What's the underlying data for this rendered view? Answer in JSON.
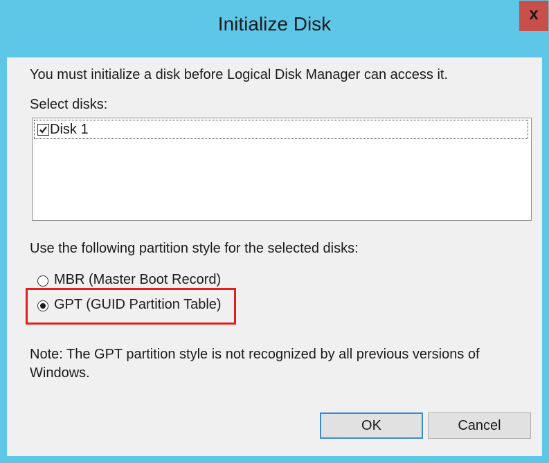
{
  "window": {
    "title": "Initialize Disk",
    "close_glyph": "x",
    "titlebar_color": "#5ec7e8",
    "close_color": "#c7504a"
  },
  "content": {
    "instruction": "You must initialize a disk before Logical Disk Manager can access it.",
    "select_label": "Select disks:",
    "disks": [
      {
        "label": "Disk 1",
        "checked": true
      }
    ],
    "partition_label": "Use the following partition style for the selected disks:",
    "options": [
      {
        "label": "MBR (Master Boot Record)",
        "selected": false
      },
      {
        "label": "GPT (GUID Partition Table)",
        "selected": true
      }
    ],
    "highlight_color": "#e0201c",
    "note": "Note: The GPT partition style is not recognized by all previous versions of Windows."
  },
  "buttons": {
    "ok": "OK",
    "cancel": "Cancel"
  }
}
